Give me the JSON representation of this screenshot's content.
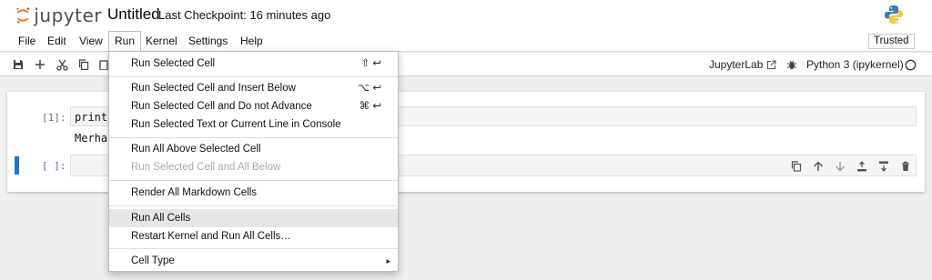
{
  "header": {
    "logo_text": "jupyter",
    "notebook_title": "Untitled",
    "checkpoint": "Last Checkpoint: 16 minutes ago"
  },
  "menubar": {
    "items": [
      "File",
      "Edit",
      "View",
      "Run",
      "Kernel",
      "Settings",
      "Help"
    ],
    "active": "Run",
    "trusted": "Trusted"
  },
  "toolbar": {
    "jupyterlab_label": "JupyterLab",
    "kernel_label": "Python 3 (ipykernel)"
  },
  "cells": [
    {
      "prompt": "[1]:",
      "code": "print(",
      "output": "Merhab"
    },
    {
      "prompt": "[ ]:",
      "code": ""
    }
  ],
  "run_menu": {
    "items": [
      {
        "label": "Run Selected Cell",
        "shortcut": "⇧ ↩",
        "disabled": false
      },
      {
        "label": "Run Selected Cell and Insert Below",
        "shortcut": "⌥ ↩",
        "disabled": false
      },
      {
        "label": "Run Selected Cell and Do not Advance",
        "shortcut": "⌘ ↩",
        "disabled": false
      },
      {
        "label": "Run Selected Text or Current Line in Console",
        "shortcut": "",
        "disabled": false
      },
      {
        "label": "Run All Above Selected Cell",
        "shortcut": "",
        "disabled": false
      },
      {
        "label": "Run Selected Cell and All Below",
        "shortcut": "",
        "disabled": true
      },
      {
        "label": "Render All Markdown Cells",
        "shortcut": "",
        "disabled": false
      },
      {
        "label": "Run All Cells",
        "shortcut": "",
        "disabled": false,
        "highlighted": true
      },
      {
        "label": "Restart Kernel and Run All Cells…",
        "shortcut": "",
        "disabled": false
      },
      {
        "label": "Cell Type",
        "shortcut": "▸",
        "disabled": false
      }
    ]
  },
  "colors": {
    "accent": "#1976d2",
    "jupyter_orange": "#f37726"
  }
}
